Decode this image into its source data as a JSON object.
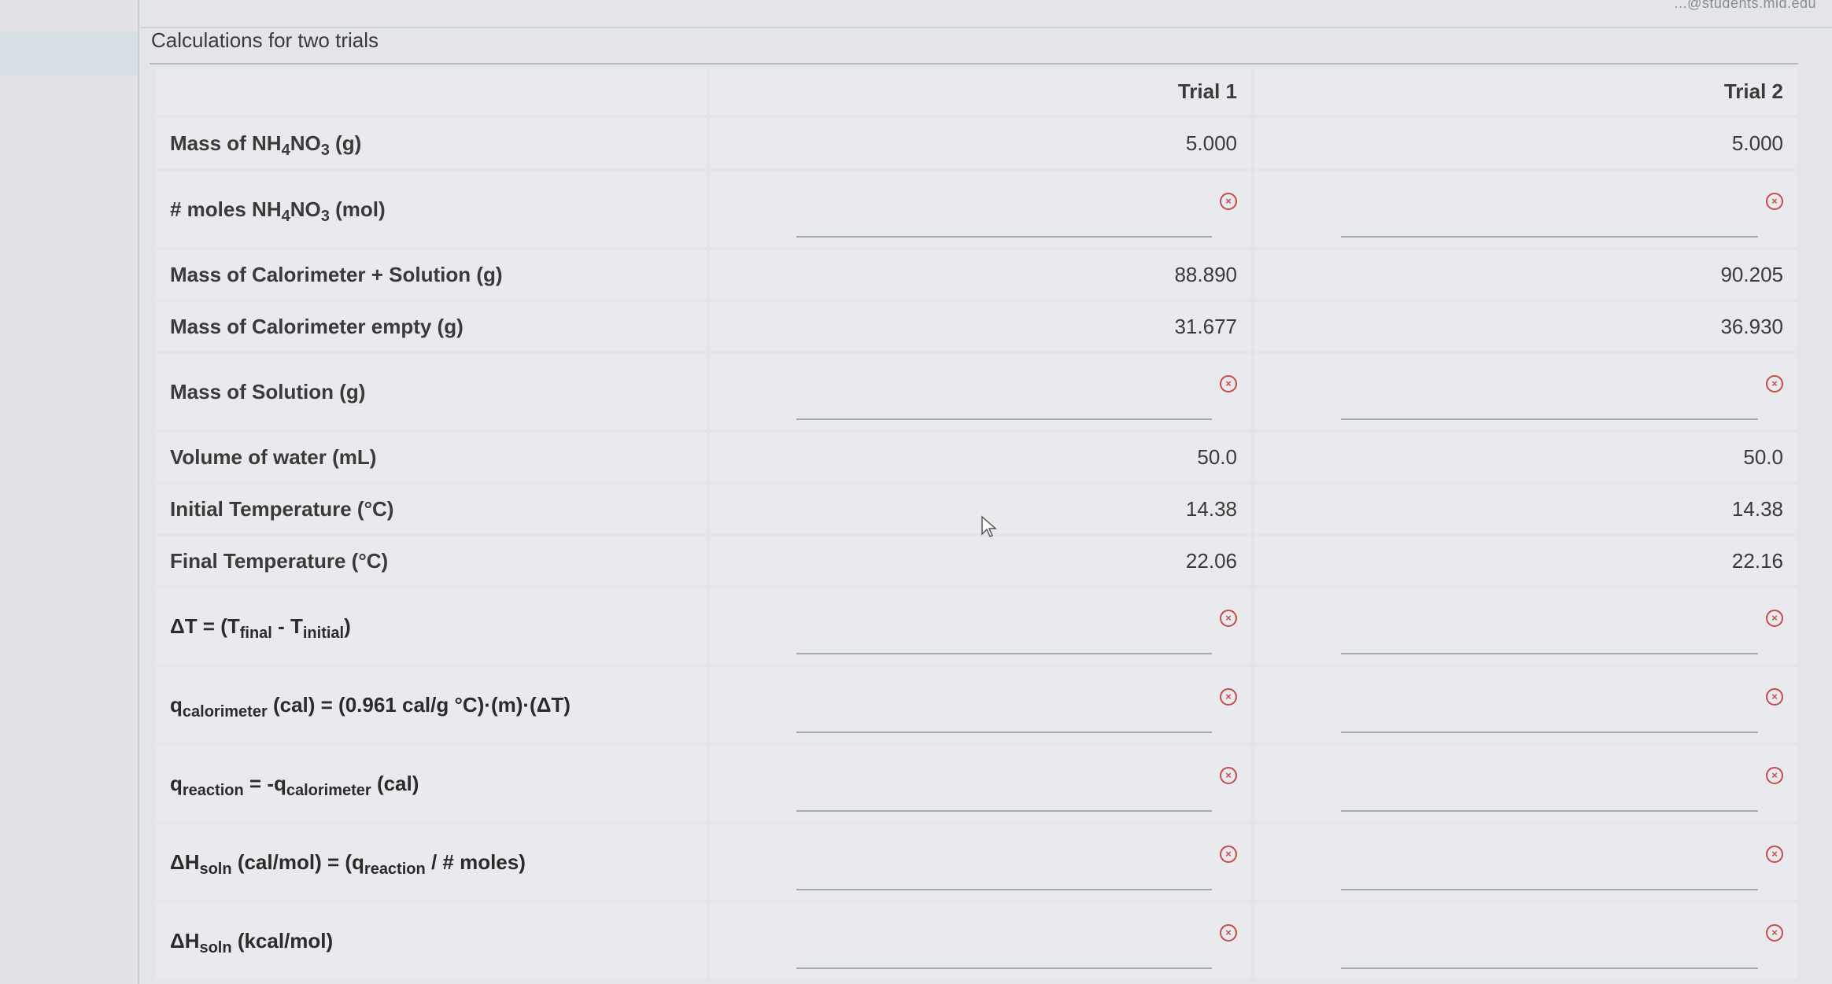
{
  "header": {
    "corner_text": "...@students.mid.edu"
  },
  "section": {
    "title": "Calculations for two trials"
  },
  "table": {
    "columns": [
      "Trial 1",
      "Trial 2"
    ],
    "rows": {
      "mass_nh4no3": {
        "label_pre": "Mass of NH",
        "label_sub1": "4",
        "label_mid": "NO",
        "label_sub2": "3",
        "label_post": " (g)",
        "trial1": "5.000",
        "trial2": "5.000"
      },
      "moles_nh4no3": {
        "label_pre": "# moles NH",
        "label_sub1": "4",
        "label_mid": "NO",
        "label_sub2": "3",
        "label_post": " (mol)",
        "trial1_value": "",
        "trial2_value": ""
      },
      "mass_cal_solution": {
        "label": "Mass of Calorimeter + Solution (g)",
        "trial1": "88.890",
        "trial2": "90.205"
      },
      "mass_cal_empty": {
        "label": "Mass of Calorimeter empty (g)",
        "trial1": "31.677",
        "trial2": "36.930"
      },
      "mass_solution": {
        "label": "Mass of Solution (g)",
        "trial1_value": "",
        "trial2_value": ""
      },
      "volume_water": {
        "label": "Volume of water (mL)",
        "trial1": "50.0",
        "trial2": "50.0"
      },
      "initial_temp": {
        "label": "Initial Temperature (°C)",
        "trial1": "14.38",
        "trial2": "14.38"
      },
      "final_temp": {
        "label": "Final Temperature (°C)",
        "trial1": "22.06",
        "trial2": "22.16"
      },
      "delta_t": {
        "label_pre": "ΔT = (T",
        "label_sub1": "final",
        "label_mid": " - T",
        "label_sub2": "initial",
        "label_post": ")",
        "trial1_value": "",
        "trial2_value": ""
      },
      "q_calorimeter": {
        "label_pre": "q",
        "label_sub1": "calorimeter",
        "label_post": " (cal) = (0.961 cal/g °C)·(m)·(ΔT)",
        "trial1_value": "",
        "trial2_value": ""
      },
      "q_reaction": {
        "label_pre": "q",
        "label_sub1": "reaction",
        "label_mid": " = -q",
        "label_sub2": "calorimeter",
        "label_post": " (cal)",
        "trial1_value": "",
        "trial2_value": ""
      },
      "dh_soln_cal": {
        "label_pre": "ΔH",
        "label_sub1": "soln",
        "label_mid": " (cal/mol) = (q",
        "label_sub2": "reaction",
        "label_post": " / # moles)",
        "trial1_value": "",
        "trial2_value": ""
      },
      "dh_soln_kcal": {
        "label_pre": "ΔH",
        "label_sub1": "soln",
        "label_post": " (kcal/mol)",
        "trial1_value": "",
        "trial2_value": ""
      }
    }
  },
  "icons": {
    "error_icon": "error-circle-x-icon",
    "error_glyph": "×",
    "error_color": "#c94a4a"
  }
}
